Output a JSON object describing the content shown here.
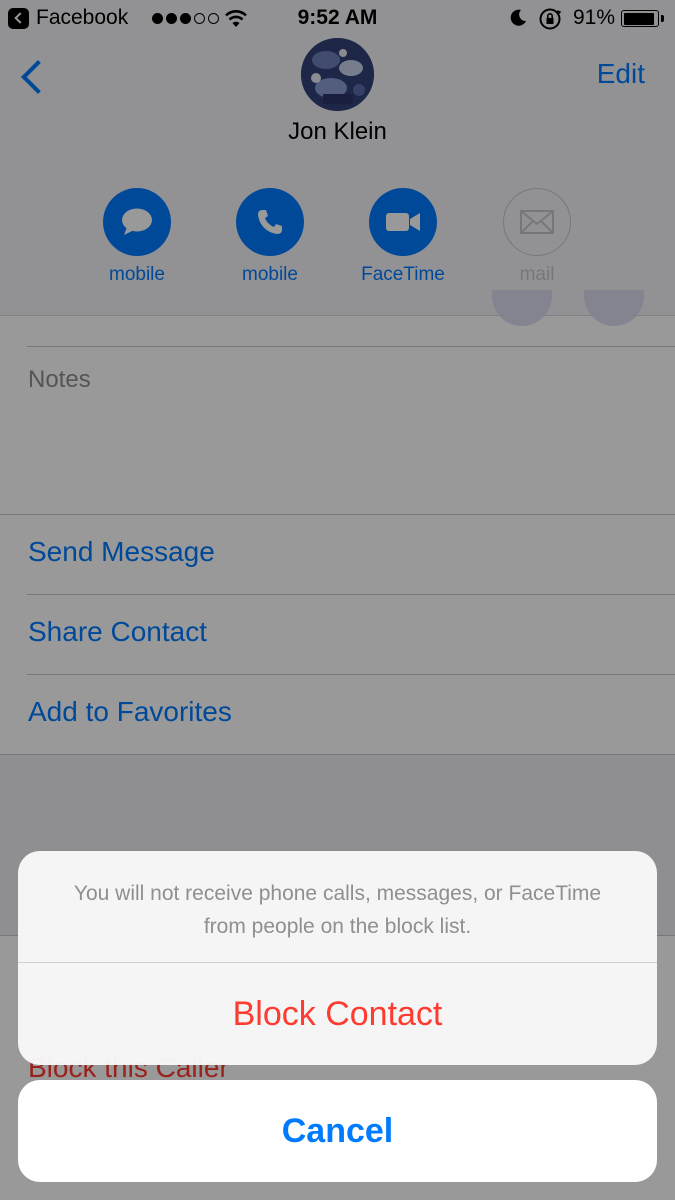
{
  "status_bar": {
    "back_app": "Facebook",
    "signal_dots_filled": 3,
    "signal_dots_total": 5,
    "time": "9:52 AM",
    "battery_percent": "91%",
    "battery_level": 0.91
  },
  "nav": {
    "back_icon": "chevron-left-icon",
    "edit_label": "Edit"
  },
  "contact": {
    "name": "Jon Klein"
  },
  "actions": [
    {
      "icon": "message-bubble-icon",
      "label": "mobile",
      "enabled": true
    },
    {
      "icon": "phone-icon",
      "label": "mobile",
      "enabled": true
    },
    {
      "icon": "video-camera-icon",
      "label": "FaceTime",
      "enabled": true
    },
    {
      "icon": "envelope-icon",
      "label": "mail",
      "enabled": false
    }
  ],
  "sections": {
    "notes_label": "Notes",
    "rows": [
      "Send Message",
      "Share Contact",
      "Add to Favorites"
    ],
    "block_row": "Block this Caller"
  },
  "action_sheet": {
    "message": "You will not receive phone calls, messages, or FaceTime from people on the block list.",
    "destructive_label": "Block Contact",
    "cancel_label": "Cancel"
  },
  "colors": {
    "accent": "#007aff",
    "destructive": "#ff3b30",
    "disabled": "#c7c7cc"
  }
}
